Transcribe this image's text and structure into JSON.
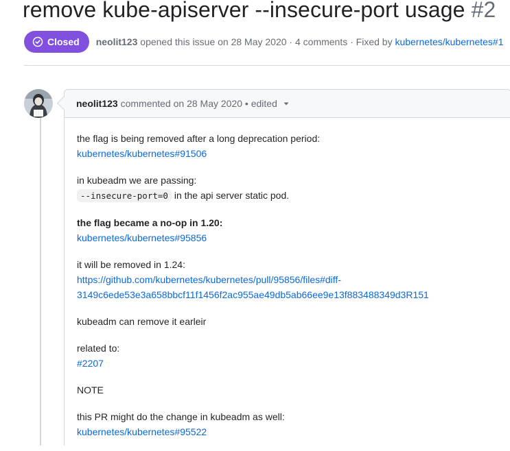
{
  "issue": {
    "title": "remove kube-apiserver --insecure-port usage",
    "number": "#2",
    "status": "Closed",
    "author": "neolit123",
    "opened_text": "opened this issue on 28 May 2020 · 4 comments · Fixed by",
    "fixed_by": "kubernetes/kubernetes#1"
  },
  "comment": {
    "author": "neolit123",
    "meta": "commented on 28 May 2020 • edited",
    "body": {
      "p1_text": "the flag is being removed after a long deprecation period:",
      "p1_link": "kubernetes/kubernetes#91506",
      "p2_text": "in kubeadm we are passing:",
      "p2_code": "--insecure-port=0",
      "p2_suffix": "in the api server static pod.",
      "p3_bold": "the flag became a no-op in 1.20:",
      "p3_link": "kubernetes/kubernetes#95856",
      "p4_text": "it will be removed in 1.24:",
      "p4_link_line1": "https://github.com/kubernetes/kubernetes/pull/95856/files#diff-",
      "p4_link_line2": "3149c6ede53e3a658bbcf11f1456f2ac955ae49db5ab66ee9e13f883488349d3R151",
      "p5_text": "kubeadm can remove it earleir",
      "p6_text": "related to:",
      "p6_link": "#2207",
      "p7_text": "NOTE",
      "p8_text": "this PR might do the change in kubeadm as well:",
      "p8_link": "kubernetes/kubernetes#95522"
    }
  },
  "icons": {
    "status": "issue-closed-icon",
    "caret": "triangle-down-icon",
    "avatar": "user-avatar"
  },
  "colors": {
    "closed_badge": "#8250df",
    "link": "#0969da",
    "muted": "#656d76"
  }
}
